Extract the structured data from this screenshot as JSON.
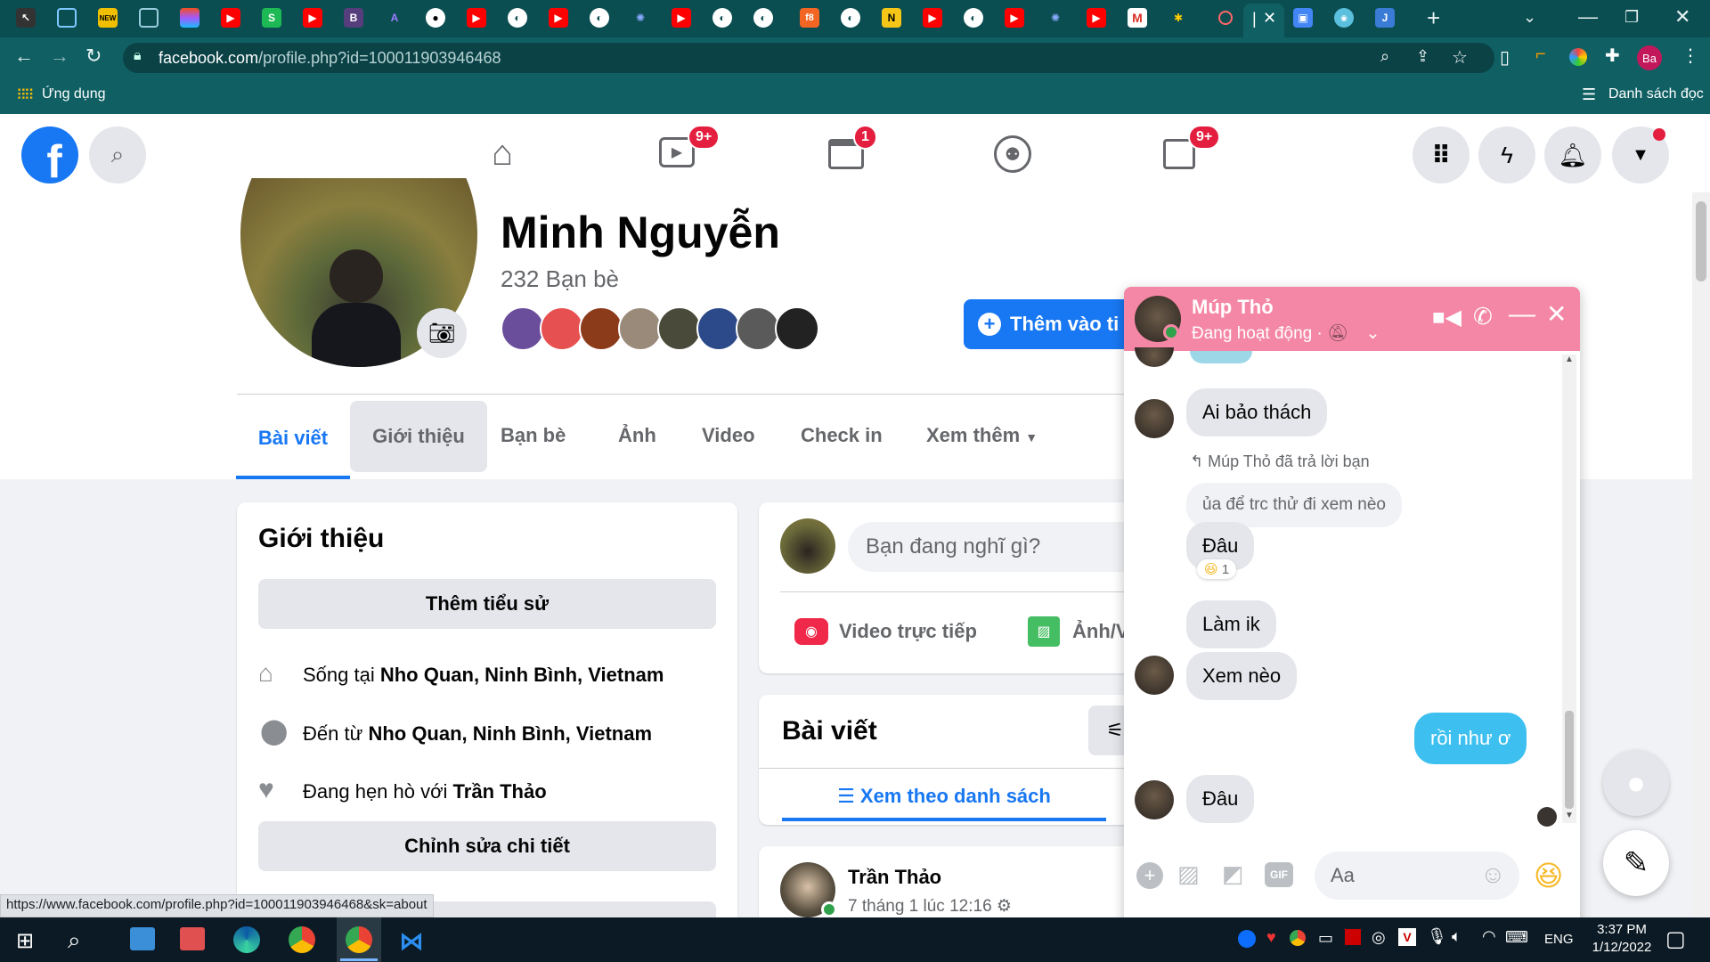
{
  "browser": {
    "url_host": "facebook.com",
    "url_path": "/profile.php?id=100011903946468",
    "bookmark_apps": "Ứng dụng",
    "reading_list": "Danh sách đọc",
    "profile_initial": "Ba",
    "new_tab": "+",
    "status_url": "https://www.facebook.com/profile.php?id=100011903946468&sk=about"
  },
  "fb_nav": {
    "watch_badge": "9+",
    "marketplace_badge": "1",
    "gaming_badge": "9+"
  },
  "profile": {
    "name": "Minh Nguyễn",
    "friends_count": "232 Bạn bè",
    "add_story_label": "Thêm vào ti",
    "tabs": [
      "Bài viết",
      "Giới thiệu",
      "Bạn bè",
      "Ảnh",
      "Video",
      "Check in",
      "Xem thêm"
    ]
  },
  "intro": {
    "title": "Giới thiệu",
    "add_bio": "Thêm tiểu sử",
    "lives_prefix": "Sống tại ",
    "lives_place": "Nho Quan, Ninh Bình, Vietnam",
    "from_prefix": "Đến từ ",
    "from_place": "Nho Quan, Ninh Bình, Vietnam",
    "dating_prefix": "Đang hẹn hò với ",
    "dating_name": "Trần Thảo",
    "edit_details": "Chỉnh sửa chi tiết"
  },
  "composer": {
    "placeholder": "Bạn đang nghĩ gì?",
    "live_video": "Video trực tiếp",
    "photo": "Ảnh/V"
  },
  "posts": {
    "title": "Bài viết",
    "list_view": "Xem theo danh sách",
    "post_author": "Trần Thảo",
    "post_time": "7 tháng 1 lúc 12:16"
  },
  "chat": {
    "name": "Múp Thỏ",
    "status": "Đang hoạt động ·",
    "reply_note": "Múp Thỏ đã trả lời bạn",
    "messages": [
      {
        "text": "Ai bảo thách"
      },
      {
        "text": "ủa để trc thử đi xem nèo"
      },
      {
        "text": "Đâu",
        "reaction": "1"
      },
      {
        "text": "Làm ik"
      },
      {
        "text": "Xem nèo"
      },
      {
        "text": "rồi như ơ"
      },
      {
        "text": "Đâu"
      }
    ],
    "input_placeholder": "Aa",
    "gif_label": "GIF"
  },
  "taskbar": {
    "time": "3:37 PM",
    "date": "1/12/2022",
    "lang": "ENG"
  },
  "colors": {
    "fb_blue": "#1877f2",
    "chat_header": "#f587a6",
    "my_bubble": "#3dc0f0",
    "browser_frame": "#0f5f63"
  }
}
